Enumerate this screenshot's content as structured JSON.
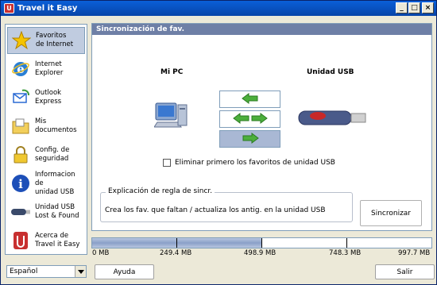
{
  "window": {
    "title": "Travel it Easy"
  },
  "titlebar_buttons": {
    "minimize": "_",
    "maximize": "□",
    "close": "×"
  },
  "sidebar": {
    "items": [
      {
        "label": "Favoritos\nde Internet",
        "icon": "star-icon",
        "active": true
      },
      {
        "label": "Internet\nExplorer",
        "icon": "internet-explorer-icon"
      },
      {
        "label": "Outlook\nExpress",
        "icon": "outlook-express-icon"
      },
      {
        "label": "Mis\ndocumentos",
        "icon": "folder-icon"
      },
      {
        "label": "Config. de\nseguridad",
        "icon": "lock-icon"
      },
      {
        "label": "Informacion de\nunidad USB",
        "icon": "info-icon"
      },
      {
        "label": "Unidad USB\nLost & Found",
        "icon": "usb-drive-icon"
      },
      {
        "label": "Acerca de\nTravel it Easy",
        "icon": "app-logo-icon"
      }
    ]
  },
  "panel": {
    "header": "Sincronización de fav.",
    "left_label": "Mi PC",
    "right_label": "Unidad USB",
    "checkbox_label": "Eliminar primero los favoritos de unidad USB",
    "checkbox_checked": false,
    "rule_legend": "Explicación de regla de sincr.",
    "rule_text": "Crea los fav. que faltan / actualiza los antig. en la unidad USB",
    "sync_button": "Sincronizar",
    "direction_selected": "usb-to-pc"
  },
  "capacity": {
    "fill_fraction": 0.5,
    "labels": [
      "0 MB",
      "249.4 MB",
      "498.9 MB",
      "748.3 MB",
      "997.7 MB"
    ]
  },
  "footer": {
    "language": "Español",
    "help_button": "Ayuda",
    "exit_button": "Salir"
  },
  "colors": {
    "accent": "#6e7fa6",
    "arrow_green": "#4caf3c",
    "selection": "#a9b8d4"
  }
}
